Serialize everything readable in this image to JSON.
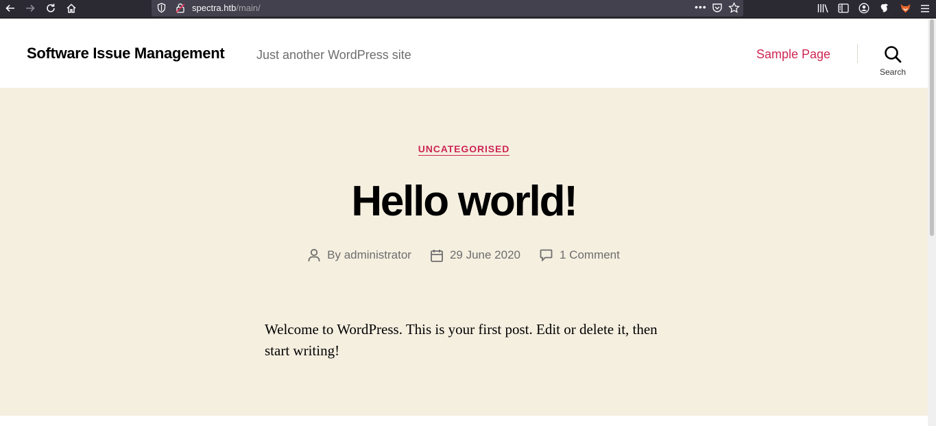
{
  "browser": {
    "url_host": "spectra.htb",
    "url_path": "/main/",
    "more_label": "•••"
  },
  "site": {
    "title": "Software Issue Management",
    "description": "Just another WordPress site",
    "nav": {
      "sample_page": "Sample Page"
    },
    "search_label": "Search"
  },
  "post": {
    "category": "UNCATEGORISED",
    "title": "Hello world!",
    "author_prefix": "By",
    "author": "administrator",
    "date": "29 June 2020",
    "comments": "1 Comment",
    "content": "Welcome to WordPress. This is your first post. Edit or delete it, then start writing!"
  },
  "colors": {
    "accent": "#cd2653",
    "hero_bg": "#f5efe0",
    "chrome_bg": "#2b2a33"
  }
}
